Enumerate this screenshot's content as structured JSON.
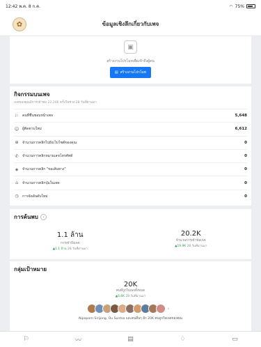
{
  "status_bar": {
    "time": "12:42 พ.ค. 8 ก.ค.",
    "battery": "75%"
  },
  "header": {
    "title": "ข้อมูลเชิงลึกเกี่ยวกับเพจ",
    "page_icon": "page-avatar-icon"
  },
  "empty_state": {
    "text": "สร้างงานโปรโมทเพื่อเข้าถึงผู้คน",
    "button_label": "สร้างงานโปรโมท"
  },
  "activity": {
    "title": "กิจกรรมบนเพจ",
    "subtitle": "เพจของคุณมีการเข้าชม 22,246 ครั้งในช่วง 28 วันที่ผ่านมา",
    "rows": [
      {
        "icon": "flag-icon",
        "glyph": "⚐",
        "label": "คนที่ชื่นชอบหน้าเพจ",
        "value": "5,648"
      },
      {
        "icon": "people-icon",
        "glyph": "☺",
        "label": "ผู้ติดตามใหม่",
        "value": "6,612"
      },
      {
        "icon": "globe-icon",
        "glyph": "⊕",
        "label": "จำนวนการคลิกไปยังเว็บไซต์ของคุณ",
        "value": "0"
      },
      {
        "icon": "phone-icon",
        "glyph": "✆",
        "label": "จำนวนการคลิกหมายเลขโทรศัพท์",
        "value": "0"
      },
      {
        "icon": "direction-icon",
        "glyph": "◈",
        "label": "จำนวนการคลิก \"ขอเส้นทาง\"",
        "value": "0"
      },
      {
        "icon": "tag-icon",
        "glyph": "⌂",
        "label": "จำนวนการคลิกปุ่มในเพจ",
        "value": "0"
      },
      {
        "icon": "clock-icon",
        "glyph": "◷",
        "label": "การจัดอันดับใหม่",
        "value": "0"
      }
    ]
  },
  "discovery": {
    "title": "การค้นพบ",
    "stats": [
      {
        "value": "1.1 ล้าน",
        "label": "การเข้าถึงเพจ",
        "change": "▲1.1 ล้าน",
        "period": "28 วันที่ผ่านมา"
      },
      {
        "value": "20.2K",
        "label": "จำนวนการเข้าชมเพจ",
        "change": "▲19.9K",
        "period": "28 วันที่ผ่านมา"
      }
    ]
  },
  "target": {
    "title": "กลุ่มเป้าหมาย",
    "value": "20K",
    "label": "คนที่ถูกใจเพจทั้งหมด",
    "change": "▲6.6K",
    "period": "28 วันที่ผ่านมา",
    "avatar_colors": [
      "#b07a4c",
      "#6d8fb8",
      "#c9a27a",
      "#7b5a44",
      "#e0a98a",
      "#8d6e63",
      "#d39c6f",
      "#5e7d9b",
      "#a4785a",
      "#cf8f86"
    ],
    "names": "Nipaporn Sirijong, Ou Suntsa และคนอื่นๆ อีก 20K คนถูกใจเพจของคุณ"
  },
  "tabbar": [
    {
      "name": "tab-pages-icon",
      "glyph": "⚐"
    },
    {
      "name": "tab-insights-icon",
      "glyph": "〰"
    },
    {
      "name": "tab-posts-icon",
      "glyph": "▤"
    },
    {
      "name": "tab-notifications-icon",
      "glyph": "♢"
    },
    {
      "name": "tab-inbox-icon",
      "glyph": "▭"
    }
  ]
}
